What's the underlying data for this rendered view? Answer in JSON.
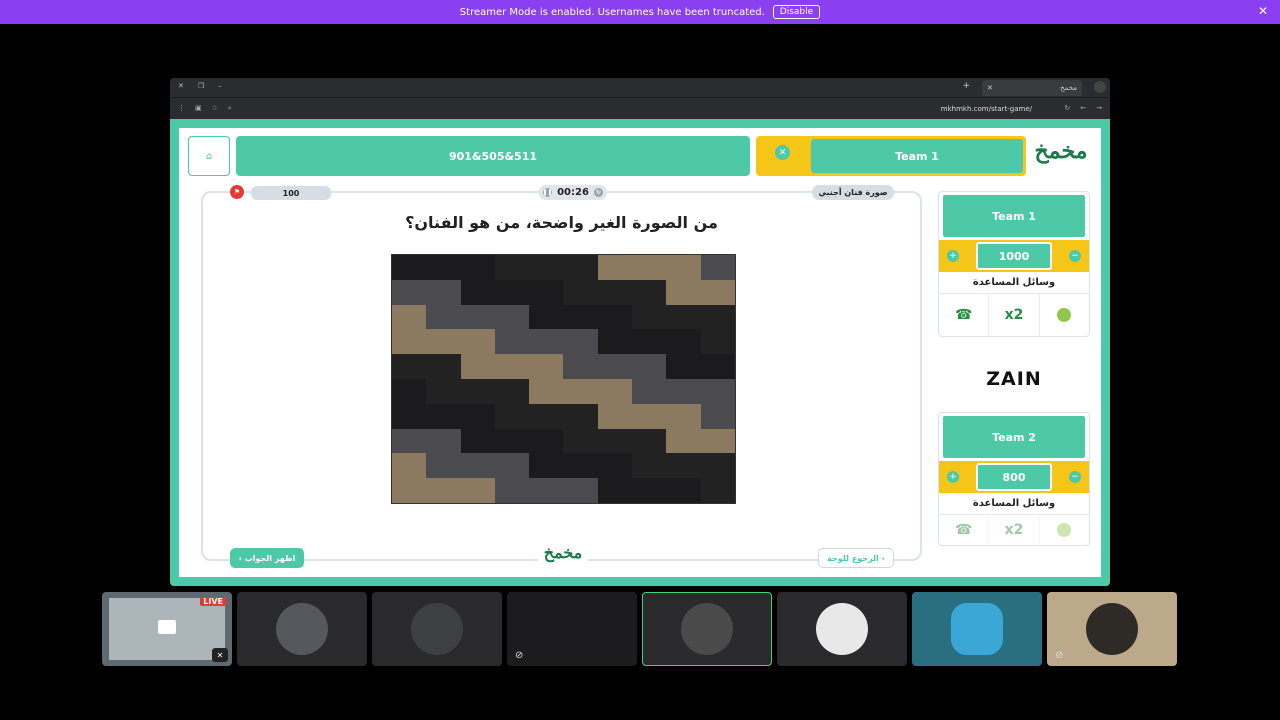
{
  "banner": {
    "text": "Streamer Mode is enabled. Usernames have been truncated.",
    "disable_label": "Disable"
  },
  "browser": {
    "tab_title": "مخمخ",
    "url": "mkhmkh.com/start-game/"
  },
  "game": {
    "logo_text": "مخمخ",
    "home_label": "الرئيسية",
    "current_team": "Team 1",
    "score_summary": "901&505&511",
    "points": "100",
    "timer": "00:26",
    "category": "صورة فنان أجنبي",
    "question": "من الصورة الغير واضحة، من هو الفنان؟",
    "reveal_button": "اظهر الجواب",
    "back_button": "الرجوع للوحة"
  },
  "teams": [
    {
      "name": "Team 1",
      "score": "1000",
      "helps_title": "وسائل المساعدة",
      "helps": [
        "x2"
      ]
    },
    {
      "name": "Team 2",
      "score": "800",
      "helps_title": "وسائل المساعدة",
      "helps": [
        "x2"
      ]
    }
  ],
  "sponsor": "ZAIN",
  "participants": {
    "live_label": "LIVE"
  },
  "colors": {
    "accent": "#4ec9a8",
    "yellow": "#f5c518",
    "banner": "#8a3ff0"
  }
}
